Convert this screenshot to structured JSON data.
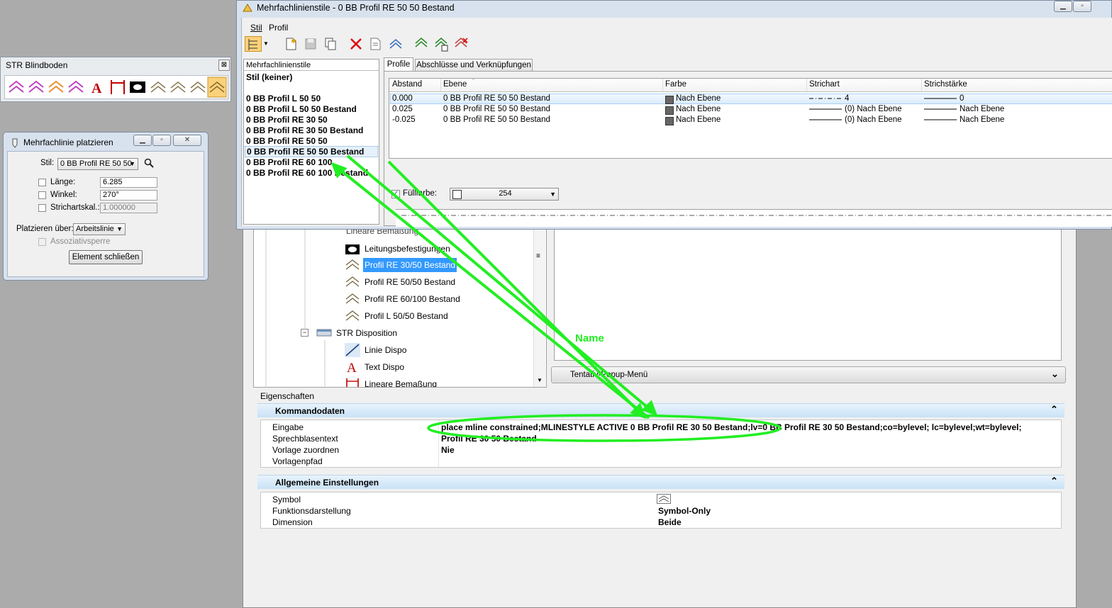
{
  "strip": {
    "title": "STR Blindboden",
    "close": "⊠"
  },
  "place_dialog": {
    "title": "Mehrfachlinie platzieren",
    "stil_label": "Stil:",
    "stil_value": "0 BB Profil RE 50 50",
    "laenge_label": "Länge:",
    "laenge_value": "6.285",
    "winkel_label": "Winkel:",
    "winkel_value": "270°",
    "strichartskal_label": "Strichartskal.:",
    "strichartskal_value": "1.000000",
    "platzieren_label": "Platzieren über:",
    "platzieren_value": "Arbeitslinie",
    "assoz_label": "Assoziativsperre",
    "close_button": "Element schließen"
  },
  "main_dialog": {
    "title": "Mehrfachlinienstile - 0 BB Profil RE 50 50 Bestand",
    "menu": [
      "Stil",
      "Profil"
    ],
    "list_header": "Mehrfachlinienstile",
    "list_current": "Stil (keiner)",
    "styles": [
      "0 BB Profil L 50 50",
      "0 BB Profil L 50 50 Bestand",
      "0 BB Profil RE 30 50",
      "0 BB Profil RE 30 50 Bestand",
      "0 BB Profil RE 50 50",
      "0 BB Profil RE 50 50 Bestand",
      "0 BB Profil RE 60 100",
      "0 BB Profil RE 60 100 Bestand"
    ],
    "tabs": [
      "Profile",
      "Abschlüsse und Verknüpfungen"
    ],
    "columns": [
      "Abstand",
      "Ebene",
      "Farbe",
      "Strichart",
      "Strichstärke"
    ],
    "rows": [
      {
        "abstand": "0.000",
        "ebene": "0 BB Profil RE 50 50 Bestand",
        "farbe": "Nach Ebene",
        "strichart": "4",
        "staerke": "0"
      },
      {
        "abstand": "0.025",
        "ebene": "0 BB Profil RE 50 50 Bestand",
        "farbe": "Nach Ebene",
        "strichart": "(0) Nach Ebene",
        "staerke": "Nach Ebene"
      },
      {
        "abstand": "-0.025",
        "ebene": "0 BB Profil RE 50 50 Bestand",
        "farbe": "Nach Ebene",
        "strichart": "(0) Nach Ebene",
        "staerke": "Nach Ebene"
      }
    ],
    "fill_label": "Füllfarbe:",
    "fill_value": "254"
  },
  "tree": {
    "items": [
      {
        "label": "Lineare Bemaßung"
      },
      {
        "label": "Leitungsbefestigungen"
      },
      {
        "label": "Profil RE 30/50 Bestand"
      },
      {
        "label": "Profil RE 50/50 Bestand"
      },
      {
        "label": "Profil RE 60/100 Bestand"
      },
      {
        "label": "Profil L 50/50 Bestand"
      },
      {
        "label": "STR Disposition"
      },
      {
        "label": "Linie Dispo"
      },
      {
        "label": "Text Dispo"
      },
      {
        "label": "Lineare Bemaßung"
      }
    ]
  },
  "popup_menu_label": "Tentativ-Popup-Menü",
  "annotation_label": "Name",
  "properties": {
    "header": "Eigenschaften",
    "section1": "Kommandodaten",
    "eingabe_label": "Eingabe",
    "eingabe_value": "place mline constrained;MLINESTYLE ACTIVE 0 BB Profil RE 30 50 Bestand;lv=0 BB Profil RE 30 50 Bestand;co=bylevel; lc=bylevel;wt=bylevel;",
    "sprech_label": "Sprechblasentext",
    "sprech_value": "Profil RE 30 50 Bestand",
    "vorlage_label": "Vorlage zuordnen",
    "vorlage_value": "Nie",
    "pfad_label": "Vorlagenpfad",
    "section2": "Allgemeine Einstellungen",
    "symbol_label": "Symbol",
    "funktion_label": "Funktionsdarstellung",
    "funktion_value": "Symbol-Only",
    "dimension_label": "Dimension",
    "dimension_value": "Beide"
  },
  "colors": {
    "highlight": "#3399ff",
    "annotation": "#22ee22",
    "section_bar": "#c9e2f6"
  }
}
